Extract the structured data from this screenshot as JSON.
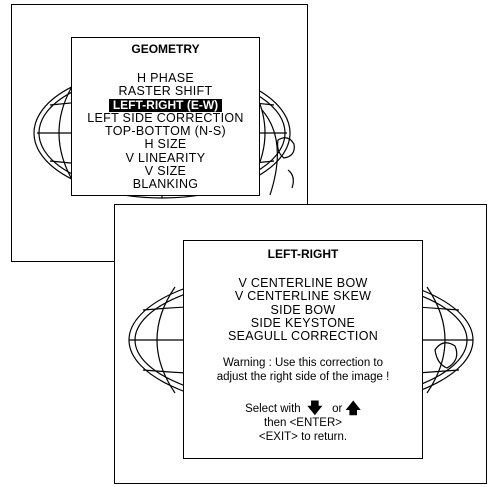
{
  "geometry_menu": {
    "title": "GEOMETRY",
    "items": [
      "H PHASE",
      "RASTER SHIFT",
      "LEFT-RIGHT (E-W)",
      "LEFT SIDE CORRECTION",
      "TOP-BOTTOM (N-S)",
      "H SIZE",
      "V LINEARITY",
      "V SIZE",
      "BLANKING"
    ],
    "selected_index": 2
  },
  "left_right_menu": {
    "title": "LEFT-RIGHT",
    "items": [
      "V CENTERLINE BOW",
      "V CENTERLINE SKEW",
      "SIDE BOW",
      "SIDE KEYSTONE",
      "SEAGULL CORRECTION"
    ],
    "warning_line1": "Warning : Use this correction to",
    "warning_line2": "adjust the right side of the image !",
    "select_prefix": "Select with",
    "select_or": "or",
    "enter_line": "then <ENTER>",
    "exit_line": "<EXIT> to return.",
    "down_arrow_icon": "down-arrow-icon",
    "up_arrow_icon": "up-arrow-icon"
  }
}
